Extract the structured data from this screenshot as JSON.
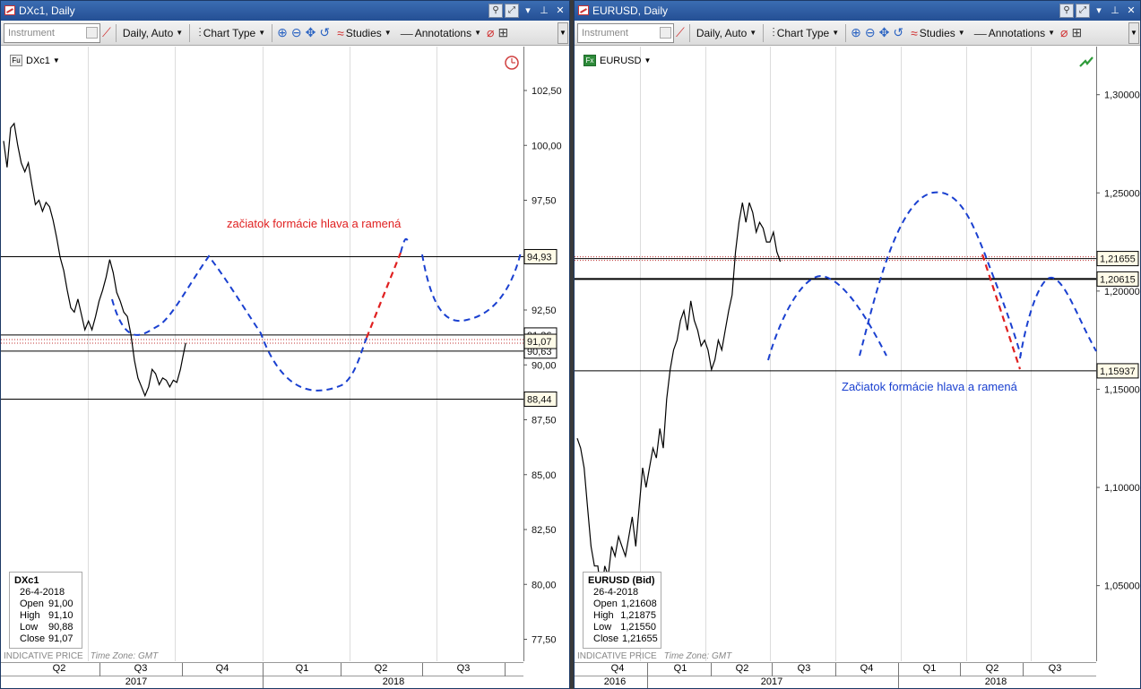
{
  "left": {
    "title": "DXc1, Daily",
    "instrument_placeholder": "Instrument",
    "interval_label": "Daily,  Auto",
    "chart_type_label": "Chart Type",
    "studies_label": "Studies",
    "annotations_label": "Annotations",
    "legend_symbol": "Fu",
    "legend_name": "DXc1",
    "annotation_text": "začiatok formácie hlava a ramená",
    "price_ticks": [
      "102,50",
      "100,00",
      "97,50",
      "95,00",
      "92,50",
      "90,00",
      "87,50",
      "85,00",
      "82,50",
      "80,00",
      "77,50"
    ],
    "price_tags": [
      "94,93",
      "91,07",
      "88,44"
    ],
    "price_tags_partial": [
      "91,36",
      "90,63"
    ],
    "info": {
      "title": "DXc1",
      "date": "26-4-2018",
      "rows": [
        {
          "k": "Open",
          "v": "91,00"
        },
        {
          "k": "High",
          "v": "91,10"
        },
        {
          "k": "Low",
          "v": "90,88"
        },
        {
          "k": "Close",
          "v": "91,07"
        }
      ]
    },
    "footer": "INDICATIVE PRICE",
    "timezone": "Time Zone: GMT",
    "quarters": [
      "Q2",
      "Q3",
      "Q4",
      "Q1",
      "Q2",
      "Q3"
    ],
    "years": [
      "2017",
      "2018"
    ]
  },
  "right": {
    "title": "EURUSD, Daily",
    "instrument_placeholder": "Instrument",
    "interval_label": "Daily,  Auto",
    "chart_type_label": "Chart Type",
    "studies_label": "Studies",
    "annotations_label": "Annotations",
    "legend_symbol": "Fx",
    "legend_name": "EURUSD",
    "annotation_text": "Začiatok formácie hlava a ramená",
    "price_ticks": [
      "1,30000",
      "1,25000",
      "1,20000",
      "1,15000",
      "1,10000",
      "1,05000"
    ],
    "price_tags": [
      "1,21655",
      "1,20615",
      "1,15937"
    ],
    "info": {
      "title": "EURUSD (Bid)",
      "date": "26-4-2018",
      "rows": [
        {
          "k": "Open",
          "v": "1,21608"
        },
        {
          "k": "High",
          "v": "1,21875"
        },
        {
          "k": "Low",
          "v": "1,21550"
        },
        {
          "k": "Close",
          "v": "1,21655"
        }
      ]
    },
    "footer": "INDICATIVE PRICE",
    "timezone": "Time Zone: GMT",
    "quarters": [
      "Q4",
      "Q1",
      "Q2",
      "Q3",
      "Q4",
      "Q1",
      "Q2",
      "Q3"
    ],
    "years": [
      "2016",
      "2017",
      "2018"
    ]
  },
  "colors": {
    "red_dash": "#e02020",
    "blue_dash": "#1a40d0",
    "annotation_red": "#e02020",
    "annotation_blue": "#1a40d0"
  },
  "chart_data": [
    {
      "type": "line",
      "title": "DXc1, Daily",
      "ylim": [
        76.5,
        104.5
      ],
      "price_ticks": [
        102.5,
        100.0,
        97.5,
        95.0,
        92.5,
        90.0,
        87.5,
        85.0,
        82.5,
        80.0,
        77.5
      ],
      "x_quarters": [
        "Q2",
        "Q3",
        "Q4",
        "Q1",
        "Q2",
        "Q3"
      ],
      "horizontal_levels": [
        94.93,
        91.36,
        90.63,
        88.44
      ],
      "last_close": 91.07,
      "series": [
        {
          "points": [
            [
              0,
              100.2
            ],
            [
              4,
              99.0
            ],
            [
              8,
              100.8
            ],
            [
              12,
              101.0
            ],
            [
              16,
              100.0
            ],
            [
              20,
              99.2
            ],
            [
              24,
              98.8
            ],
            [
              28,
              99.2
            ],
            [
              32,
              98.2
            ],
            [
              36,
              97.3
            ],
            [
              40,
              97.5
            ],
            [
              44,
              97.0
            ],
            [
              48,
              97.4
            ],
            [
              52,
              97.2
            ],
            [
              56,
              96.6
            ],
            [
              60,
              95.8
            ],
            [
              64,
              94.9
            ],
            [
              68,
              94.3
            ],
            [
              72,
              93.4
            ],
            [
              76,
              92.6
            ],
            [
              80,
              92.4
            ],
            [
              84,
              93.0
            ],
            [
              88,
              92.3
            ],
            [
              92,
              91.6
            ],
            [
              96,
              92.0
            ],
            [
              100,
              91.6
            ],
            [
              104,
              92.2
            ],
            [
              108,
              92.9
            ],
            [
              112,
              93.4
            ],
            [
              116,
              94.0
            ],
            [
              120,
              94.8
            ],
            [
              124,
              94.2
            ],
            [
              128,
              93.3
            ],
            [
              132,
              92.9
            ],
            [
              136,
              92.4
            ],
            [
              140,
              92.2
            ],
            [
              144,
              91.4
            ],
            [
              148,
              90.2
            ],
            [
              152,
              89.4
            ],
            [
              156,
              89.0
            ],
            [
              160,
              88.6
            ],
            [
              164,
              89.0
            ],
            [
              168,
              89.8
            ],
            [
              172,
              89.6
            ],
            [
              176,
              89.1
            ],
            [
              180,
              89.4
            ],
            [
              184,
              89.3
            ],
            [
              188,
              89.0
            ],
            [
              192,
              89.3
            ],
            [
              196,
              89.2
            ],
            [
              200,
              89.8
            ],
            [
              203,
              90.4
            ],
            [
              206,
              91.0
            ]
          ]
        }
      ]
    },
    {
      "type": "line",
      "title": "EURUSD, Daily",
      "ylim": [
        1.0115,
        1.3245
      ],
      "price_ticks": [
        1.3,
        1.25,
        1.2,
        1.15,
        1.1,
        1.05
      ],
      "x_quarters": [
        "Q4",
        "Q1",
        "Q2",
        "Q3",
        "Q4",
        "Q1",
        "Q2",
        "Q3"
      ],
      "horizontal_levels": [
        1.21655,
        1.20615,
        1.15937
      ],
      "last_close": 1.21655,
      "series": [
        {
          "points": [
            [
              0,
              1.125
            ],
            [
              4,
              1.12
            ],
            [
              8,
              1.11
            ],
            [
              12,
              1.09
            ],
            [
              16,
              1.07
            ],
            [
              20,
              1.06
            ],
            [
              24,
              1.06
            ],
            [
              28,
              1.045
            ],
            [
              32,
              1.06
            ],
            [
              36,
              1.055
            ],
            [
              40,
              1.07
            ],
            [
              44,
              1.065
            ],
            [
              48,
              1.075
            ],
            [
              52,
              1.07
            ],
            [
              56,
              1.065
            ],
            [
              60,
              1.075
            ],
            [
              64,
              1.085
            ],
            [
              68,
              1.07
            ],
            [
              72,
              1.09
            ],
            [
              76,
              1.11
            ],
            [
              80,
              1.1
            ],
            [
              84,
              1.11
            ],
            [
              88,
              1.12
            ],
            [
              92,
              1.115
            ],
            [
              96,
              1.13
            ],
            [
              100,
              1.12
            ],
            [
              104,
              1.145
            ],
            [
              108,
              1.16
            ],
            [
              112,
              1.17
            ],
            [
              116,
              1.175
            ],
            [
              120,
              1.185
            ],
            [
              124,
              1.19
            ],
            [
              128,
              1.18
            ],
            [
              132,
              1.195
            ],
            [
              136,
              1.185
            ],
            [
              140,
              1.18
            ],
            [
              144,
              1.172
            ],
            [
              148,
              1.175
            ],
            [
              152,
              1.17
            ],
            [
              156,
              1.16
            ],
            [
              160,
              1.165
            ],
            [
              164,
              1.175
            ],
            [
              168,
              1.17
            ],
            [
              172,
              1.18
            ],
            [
              176,
              1.19
            ],
            [
              180,
              1.198
            ],
            [
              184,
              1.22
            ],
            [
              188,
              1.235
            ],
            [
              192,
              1.245
            ],
            [
              196,
              1.235
            ],
            [
              200,
              1.245
            ],
            [
              204,
              1.24
            ],
            [
              208,
              1.23
            ],
            [
              212,
              1.235
            ],
            [
              216,
              1.232
            ],
            [
              220,
              1.225
            ],
            [
              224,
              1.225
            ],
            [
              228,
              1.23
            ],
            [
              232,
              1.22
            ],
            [
              236,
              1.215
            ]
          ]
        }
      ]
    }
  ]
}
